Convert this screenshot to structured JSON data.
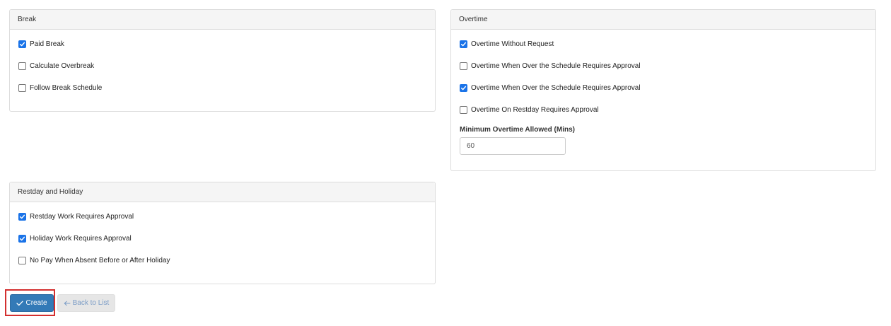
{
  "break": {
    "title": "Break",
    "items": [
      {
        "label": "Paid Break",
        "checked": true
      },
      {
        "label": "Calculate Overbreak",
        "checked": false
      },
      {
        "label": "Follow Break Schedule",
        "checked": false
      }
    ]
  },
  "overtime": {
    "title": "Overtime",
    "items": [
      {
        "label": "Overtime Without Request",
        "checked": true
      },
      {
        "label": "Overtime When Over the Schedule Requires Approval",
        "checked": false
      },
      {
        "label": "Overtime When Over the Schedule Requires Approval",
        "checked": true
      },
      {
        "label": "Overtime On Restday Requires Approval",
        "checked": false
      }
    ],
    "min_overtime": {
      "label": "Minimum Overtime Allowed (Mins)",
      "value": "60"
    }
  },
  "restday": {
    "title": "Restday and Holiday",
    "items": [
      {
        "label": "Restday Work Requires Approval",
        "checked": true
      },
      {
        "label": "Holiday Work Requires Approval",
        "checked": true
      },
      {
        "label": "No Pay When Absent Before or After Holiday",
        "checked": false
      }
    ]
  },
  "actions": {
    "create_label": "Create",
    "back_label": "Back to List",
    "create_icon": "check-icon",
    "back_icon": "arrow-left-icon"
  },
  "colors": {
    "primary": "#337ab7",
    "checkbox_checked": "#1a73e8",
    "highlight": "#d32f2f"
  }
}
